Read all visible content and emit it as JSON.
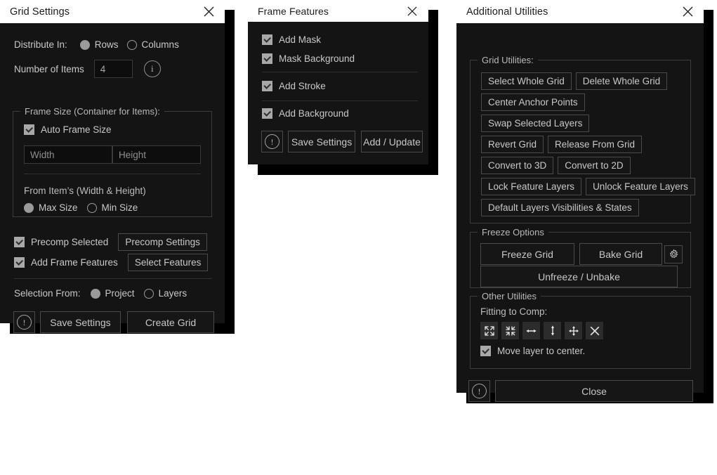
{
  "panels": {
    "grid_settings": {
      "title": "Grid Settings",
      "close_icon": "close-icon",
      "distribute": {
        "label": "Distribute In:",
        "options": [
          {
            "label": "Rows",
            "selected": true
          },
          {
            "label": "Columns",
            "selected": false
          }
        ]
      },
      "number_of_items": {
        "label": "Number of Items",
        "value": "4",
        "info_icon": "info-icon",
        "info_glyph": "i"
      },
      "frame_size": {
        "legend": "Frame Size (Container for Items):",
        "auto_frame_size": {
          "label": "Auto Frame Size",
          "checked": true
        },
        "width_placeholder": "Width",
        "height_placeholder": "Height",
        "from_items_label": "From Item’s (Width & Height)",
        "size_options": [
          {
            "label": "Max Size",
            "selected": true
          },
          {
            "label": "Min Size",
            "selected": false
          }
        ]
      },
      "precomp": {
        "label": "Precomp Selected",
        "checked": true,
        "button": "Precomp Settings"
      },
      "frame_features": {
        "label": "Add Frame Features",
        "checked": true,
        "button": "Select Features"
      },
      "selection_from": {
        "label": "Selection From:",
        "options": [
          {
            "label": "Project",
            "selected": true
          },
          {
            "label": "Layers",
            "selected": false
          }
        ]
      },
      "footer": {
        "alert_icon": "alert-icon",
        "alert_glyph": "!",
        "save": "Save Settings",
        "primary": "Create Grid"
      }
    },
    "frame_features": {
      "title": "Frame Features",
      "close_icon": "close-icon",
      "checks": [
        {
          "label": "Add Mask",
          "checked": true
        },
        {
          "label": "Mask Background",
          "checked": true
        },
        {
          "label": "Add Stroke",
          "checked": true
        },
        {
          "label": "Add Background",
          "checked": true
        }
      ],
      "footer": {
        "alert_icon": "alert-icon",
        "alert_glyph": "!",
        "save": "Save Settings",
        "primary": "Add / Update"
      }
    },
    "additional_utilities": {
      "title": "Additional Utilities",
      "close_icon": "close-icon",
      "grid_utilities": {
        "legend": "Grid Utilities:",
        "rows": [
          [
            "Select Whole Grid",
            "Delete Whole Grid"
          ],
          [
            "Center Anchor Points"
          ],
          [
            "Swap Selected Layers"
          ],
          [
            "Revert Grid",
            "Release From Grid"
          ],
          [
            "Convert to 3D",
            "Convert to 2D"
          ],
          [
            "Lock Feature Layers",
            "Unlock Feature Layers"
          ],
          [
            "Default Layers Visibilities & States"
          ]
        ]
      },
      "freeze_options": {
        "legend": "Freeze Options",
        "freeze": "Freeze Grid",
        "bake": "Bake Grid",
        "gear_icon": "gear-icon",
        "unfreeze": "Unfreeze / Unbake"
      },
      "other_utilities": {
        "legend": "Other Utilities",
        "fitting_label": "Fitting to Comp:",
        "fitting_icons": [
          "fit-expand-icon",
          "fit-shrink-icon",
          "fit-horizontal-icon",
          "fit-vertical-icon",
          "fit-move-icon",
          "fit-clear-icon"
        ],
        "move_to_center": {
          "label": "Move layer to center.",
          "checked": true
        }
      },
      "footer": {
        "alert_icon": "alert-icon",
        "alert_glyph": "!",
        "close": "Close"
      }
    }
  },
  "colors": {
    "panel_body": "#141414",
    "titlebar": "#ffffff",
    "title_text": "#1c1c1c",
    "text": "#c9c9c9",
    "border": "#4a4a4a",
    "group_border": "#3d3d3d",
    "checkbox_fill": "#a8a8a8",
    "radio_fill": "#9a9a9a"
  }
}
